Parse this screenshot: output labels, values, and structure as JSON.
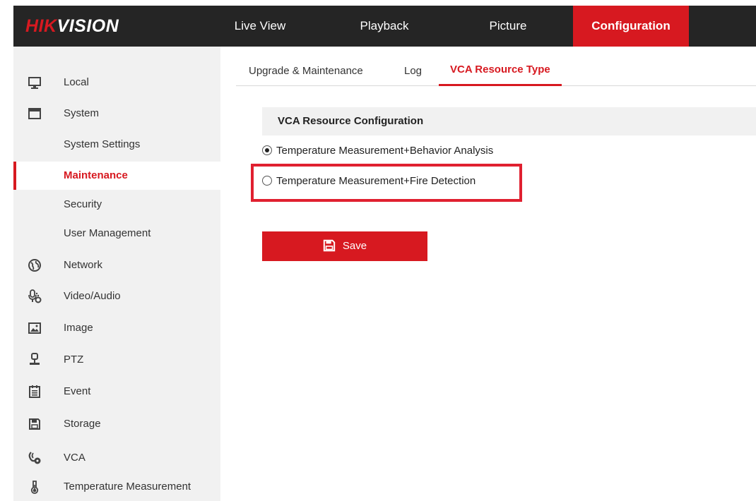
{
  "brand": {
    "logo_red": "HIK",
    "logo_white": "VISION"
  },
  "nav": {
    "live_view": "Live View",
    "playback": "Playback",
    "picture": "Picture",
    "configuration": "Configuration"
  },
  "sidebar": {
    "items": [
      {
        "label": "Local",
        "icon": "monitor-icon"
      },
      {
        "label": "System",
        "icon": "window-icon"
      },
      {
        "label": "System Settings"
      },
      {
        "label": "Maintenance",
        "active": true
      },
      {
        "label": "Security"
      },
      {
        "label": "User Management"
      },
      {
        "label": "Network",
        "icon": "globe-icon"
      },
      {
        "label": "Video/Audio",
        "icon": "microphone-icon"
      },
      {
        "label": "Image",
        "icon": "image-icon"
      },
      {
        "label": "PTZ",
        "icon": "ptz-camera-icon"
      },
      {
        "label": "Event",
        "icon": "calendar-icon"
      },
      {
        "label": "Storage",
        "icon": "floppy-disk-icon"
      },
      {
        "label": "VCA",
        "icon": "vca-icon"
      },
      {
        "label": "Temperature Measurement",
        "icon": "thermometer-icon"
      }
    ]
  },
  "tabs": {
    "upgrade": "Upgrade & Maintenance",
    "log": "Log",
    "vca_resource_type": "VCA Resource Type"
  },
  "section": {
    "title": "VCA Resource Configuration",
    "options": [
      {
        "label": "Temperature Measurement+Behavior Analysis",
        "selected": true
      },
      {
        "label": "Temperature Measurement+Fire Detection",
        "selected": false
      }
    ]
  },
  "actions": {
    "save": "Save"
  },
  "colors": {
    "accent": "#d71920",
    "topbar": "#252525",
    "sidebar_bg": "#f1f1f1",
    "highlight": "#e02030"
  }
}
